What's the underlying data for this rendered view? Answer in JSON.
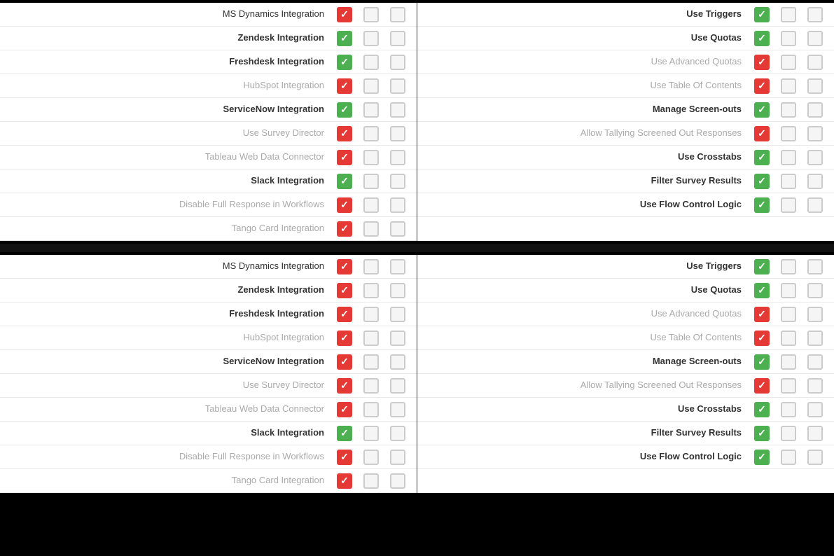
{
  "panels": [
    {
      "left": {
        "rows": [
          {
            "label": "MS Dynamics Integration",
            "bold": false,
            "gray": false,
            "col1": "red",
            "col2": "empty",
            "col3": "empty"
          },
          {
            "label": "Zendesk Integration",
            "bold": true,
            "gray": false,
            "col1": "green",
            "col2": "empty",
            "col3": "empty"
          },
          {
            "label": "Freshdesk Integration",
            "bold": true,
            "gray": false,
            "col1": "green",
            "col2": "empty",
            "col3": "empty"
          },
          {
            "label": "HubSpot Integration",
            "bold": false,
            "gray": true,
            "col1": "red",
            "col2": "empty",
            "col3": "empty"
          },
          {
            "label": "ServiceNow Integration",
            "bold": true,
            "gray": false,
            "col1": "green",
            "col2": "empty",
            "col3": "empty"
          },
          {
            "label": "Use Survey Director",
            "bold": false,
            "gray": true,
            "col1": "red",
            "col2": "empty",
            "col3": "empty"
          },
          {
            "label": "Tableau Web Data Connector",
            "bold": false,
            "gray": true,
            "col1": "red",
            "col2": "empty",
            "col3": "empty"
          },
          {
            "label": "Slack Integration",
            "bold": true,
            "gray": false,
            "col1": "green",
            "col2": "empty",
            "col3": "empty"
          },
          {
            "label": "Disable Full Response in Workflows",
            "bold": false,
            "gray": true,
            "col1": "red",
            "col2": "empty",
            "col3": "empty"
          },
          {
            "label": "Tango Card Integration",
            "bold": false,
            "gray": true,
            "col1": "red",
            "col2": "empty",
            "col3": "empty"
          }
        ]
      },
      "right": {
        "rows": [
          {
            "label": "Use Triggers",
            "bold": true,
            "gray": false,
            "col1": "green",
            "col2": "empty",
            "col3": "empty"
          },
          {
            "label": "Use Quotas",
            "bold": true,
            "gray": false,
            "col1": "green",
            "col2": "empty",
            "col3": "empty"
          },
          {
            "label": "Use Advanced Quotas",
            "bold": false,
            "gray": true,
            "col1": "red",
            "col2": "empty",
            "col3": "empty"
          },
          {
            "label": "Use Table Of Contents",
            "bold": false,
            "gray": true,
            "col1": "red",
            "col2": "empty",
            "col3": "empty"
          },
          {
            "label": "Manage Screen-outs",
            "bold": true,
            "gray": false,
            "col1": "green",
            "col2": "empty",
            "col3": "empty"
          },
          {
            "label": "Allow Tallying Screened Out Responses",
            "bold": false,
            "gray": true,
            "col1": "red",
            "col2": "empty",
            "col3": "empty"
          },
          {
            "label": "Use Crosstabs",
            "bold": true,
            "gray": false,
            "col1": "green",
            "col2": "empty",
            "col3": "empty"
          },
          {
            "label": "Filter Survey Results",
            "bold": true,
            "gray": false,
            "col1": "green",
            "col2": "empty",
            "col3": "empty"
          },
          {
            "label": "Use Flow Control Logic",
            "bold": true,
            "gray": false,
            "col1": "green",
            "col2": "empty",
            "col3": "empty"
          }
        ]
      }
    },
    {
      "left": {
        "rows": [
          {
            "label": "MS Dynamics Integration",
            "bold": false,
            "gray": false,
            "col1": "red",
            "col2": "empty",
            "col3": "empty"
          },
          {
            "label": "Zendesk Integration",
            "bold": true,
            "gray": false,
            "col1": "red",
            "col2": "empty",
            "col3": "empty"
          },
          {
            "label": "Freshdesk Integration",
            "bold": true,
            "gray": false,
            "col1": "red",
            "col2": "empty",
            "col3": "empty"
          },
          {
            "label": "HubSpot Integration",
            "bold": false,
            "gray": true,
            "col1": "red",
            "col2": "empty",
            "col3": "empty"
          },
          {
            "label": "ServiceNow Integration",
            "bold": true,
            "gray": false,
            "col1": "red",
            "col2": "empty",
            "col3": "empty"
          },
          {
            "label": "Use Survey Director",
            "bold": false,
            "gray": true,
            "col1": "red",
            "col2": "empty",
            "col3": "empty"
          },
          {
            "label": "Tableau Web Data Connector",
            "bold": false,
            "gray": true,
            "col1": "red",
            "col2": "empty",
            "col3": "empty"
          },
          {
            "label": "Slack Integration",
            "bold": true,
            "gray": false,
            "col1": "green",
            "col2": "empty",
            "col3": "empty"
          },
          {
            "label": "Disable Full Response in Workflows",
            "bold": false,
            "gray": true,
            "col1": "red",
            "col2": "empty",
            "col3": "empty"
          },
          {
            "label": "Tango Card Integration",
            "bold": false,
            "gray": true,
            "col1": "red",
            "col2": "empty",
            "col3": "empty"
          }
        ]
      },
      "right": {
        "rows": [
          {
            "label": "Use Triggers",
            "bold": true,
            "gray": false,
            "col1": "green",
            "col2": "empty",
            "col3": "empty"
          },
          {
            "label": "Use Quotas",
            "bold": true,
            "gray": false,
            "col1": "green",
            "col2": "empty",
            "col3": "empty"
          },
          {
            "label": "Use Advanced Quotas",
            "bold": false,
            "gray": true,
            "col1": "red",
            "col2": "empty",
            "col3": "empty"
          },
          {
            "label": "Use Table Of Contents",
            "bold": false,
            "gray": true,
            "col1": "red",
            "col2": "empty",
            "col3": "empty"
          },
          {
            "label": "Manage Screen-outs",
            "bold": true,
            "gray": false,
            "col1": "green",
            "col2": "empty",
            "col3": "empty"
          },
          {
            "label": "Allow Tallying Screened Out Responses",
            "bold": false,
            "gray": true,
            "col1": "red",
            "col2": "empty",
            "col3": "empty"
          },
          {
            "label": "Use Crosstabs",
            "bold": true,
            "gray": false,
            "col1": "green",
            "col2": "empty",
            "col3": "empty"
          },
          {
            "label": "Filter Survey Results",
            "bold": true,
            "gray": false,
            "col1": "green",
            "col2": "empty",
            "col3": "empty"
          },
          {
            "label": "Use Flow Control Logic",
            "bold": true,
            "gray": false,
            "col1": "green",
            "col2": "empty",
            "col3": "empty"
          }
        ]
      }
    }
  ]
}
